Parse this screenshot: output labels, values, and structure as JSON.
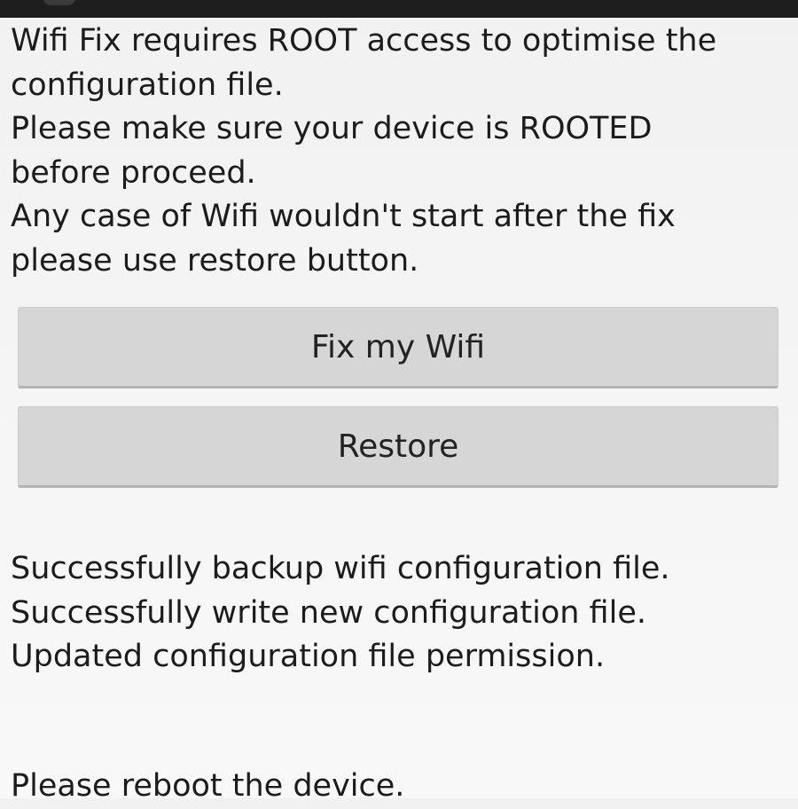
{
  "intro": {
    "lines": [
      "Wifi Fix requires ROOT access to optimise the",
      "configuration file.",
      "Please make sure your device is ROOTED",
      "before proceed.",
      "Any case of Wifi wouldn't start after the fix",
      "please use restore button."
    ]
  },
  "buttons": {
    "fix_label": "Fix my Wifi",
    "restore_label": "Restore"
  },
  "status": {
    "lines": [
      "Successfully backup wifi configuration file.",
      "Successfully write new configuration file.",
      "Updated configuration file permission."
    ]
  },
  "reboot_message": "Please reboot the device."
}
